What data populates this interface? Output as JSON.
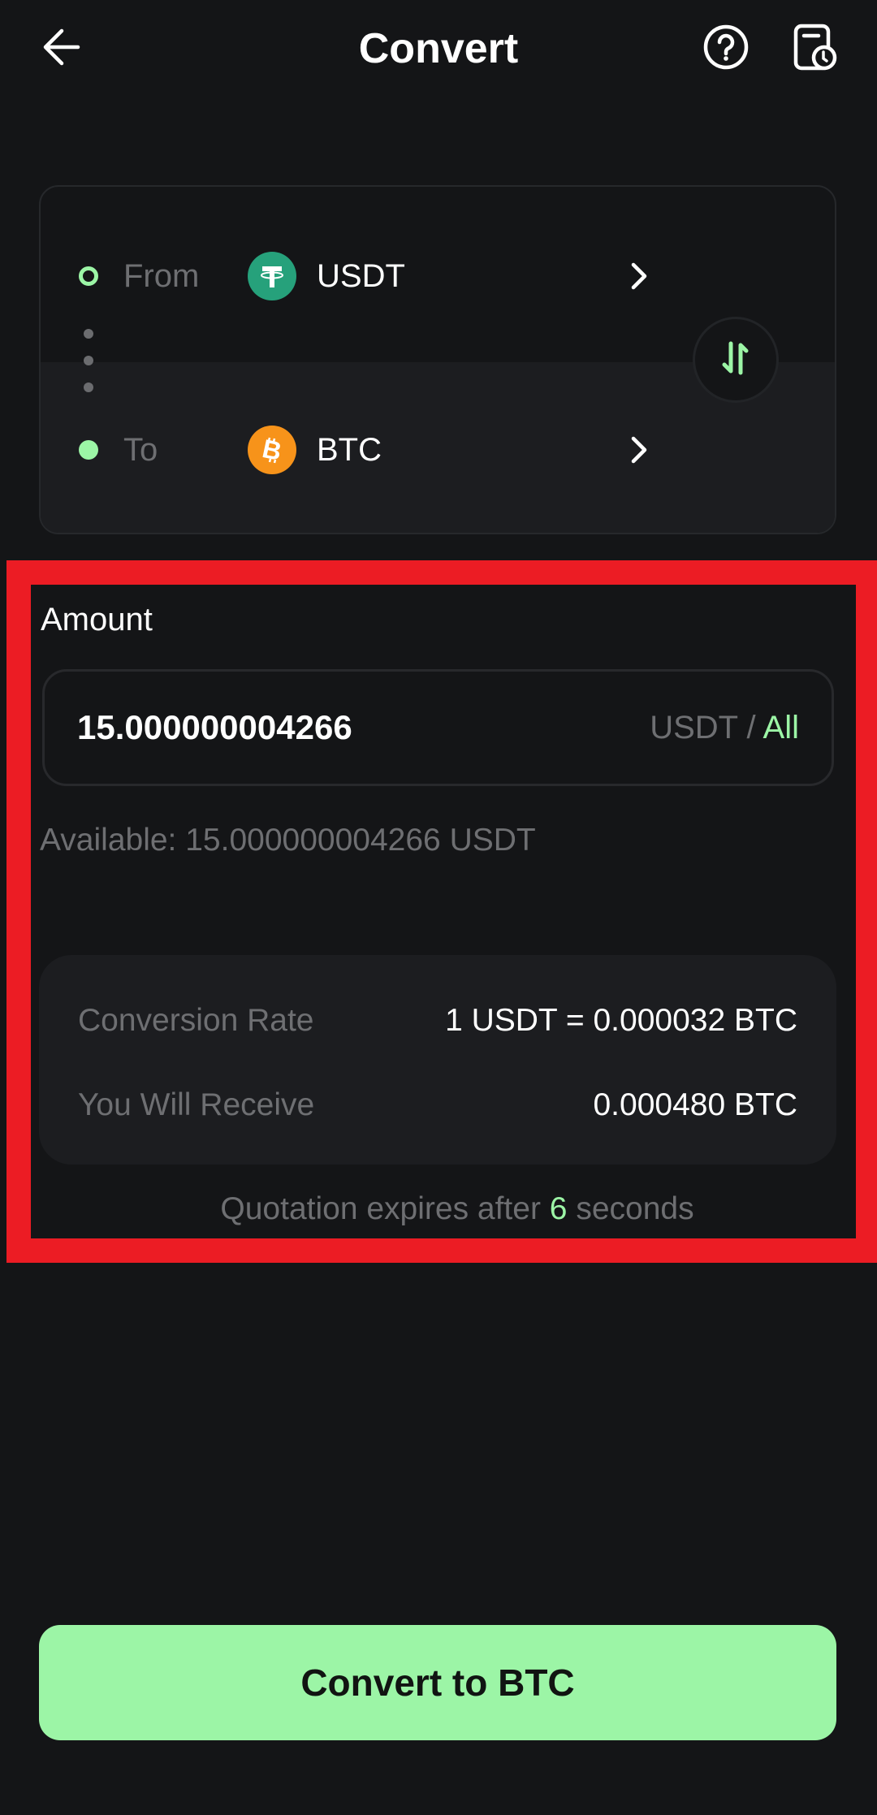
{
  "header": {
    "title": "Convert",
    "back_icon": "arrow-left-icon",
    "help_icon": "question-circle-icon",
    "history_icon": "order-history-icon"
  },
  "pair": {
    "from": {
      "label": "From",
      "coin": "USDT",
      "icon": "tether-icon",
      "color": "#26a17b"
    },
    "to": {
      "label": "To",
      "coin": "BTC",
      "icon": "bitcoin-icon",
      "color": "#f7931a"
    },
    "swap_icon": "swap-vertical-icon"
  },
  "amount": {
    "label": "Amount",
    "value": "15.000000004266",
    "unit": "USDT",
    "separator": "/",
    "all_label": "All",
    "available": "Available: 15.000000004266 USDT"
  },
  "quote": {
    "rows": [
      {
        "label": "Conversion Rate",
        "value": "1 USDT = 0.000032 BTC"
      },
      {
        "label": "You Will Receive",
        "value": "0.000480 BTC"
      }
    ],
    "expiry_prefix": "Quotation expires after",
    "expiry_seconds": "6",
    "expiry_suffix": "seconds"
  },
  "action": {
    "convert_label": "Convert to BTC"
  },
  "colors": {
    "accent": "#9cf5a6",
    "background": "#141517",
    "card": "#1c1d20",
    "muted_text": "#6e6f72",
    "highlight_border": "#ec1c24"
  }
}
